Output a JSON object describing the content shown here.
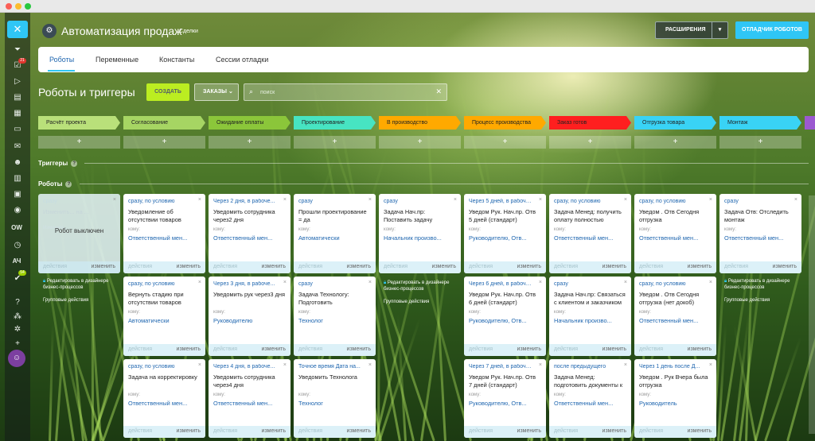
{
  "app": {
    "title": "Автоматизация продаж",
    "subtitle": "Сделки",
    "extensions_label": "РАСШИРЕНИЯ",
    "debugger_label": "ОТЛАДЧИК РОБОТОВ"
  },
  "nav": {
    "badge_tasks": "21",
    "badge_bottom": "54",
    "ow_label": "OW",
    "ac_label": "АЧ"
  },
  "tabs": [
    "Роботы",
    "Переменные",
    "Константы",
    "Сессии отладки"
  ],
  "toolbar": {
    "page_title": "Роботы и триггеры",
    "create_label": "СОЗДАТЬ",
    "orders_label": "ЗАКАЗЫ",
    "search_placeholder": "поиск"
  },
  "stages": [
    {
      "label": "Расчёт проекта",
      "color": "#b9e07a"
    },
    {
      "label": "Согласование",
      "color": "#a6d563"
    },
    {
      "label": "Ожидание оплаты",
      "color": "#8bc63a"
    },
    {
      "label": "Проектирование",
      "color": "#47e4c2"
    },
    {
      "label": "В производство",
      "color": "#ffa900"
    },
    {
      "label": "Процесс производства",
      "color": "#ffa900"
    },
    {
      "label": "Заказ готов",
      "color": "#ff1f1f"
    },
    {
      "label": "Отгрузка товара",
      "color": "#39d3f5"
    },
    {
      "label": "Монтаж",
      "color": "#39d3f5"
    }
  ],
  "add_symbol": "+",
  "sections": {
    "triggers": "Триггеры",
    "robots": "Роботы"
  },
  "card_labels": {
    "komu": "кому:",
    "action": "действия",
    "change": "изменить",
    "close": "×"
  },
  "disabled_card": {
    "text": "Робот выключен",
    "faded_cond": "сразу",
    "faded_title": "Изменить... на ...",
    "faded_sub": "Изменить..."
  },
  "designer_note": {
    "line1": "Редактировать в дизайнере",
    "line2": "бизнес-процессов",
    "group": "Групповые действия"
  },
  "robots": [
    {
      "col": 1,
      "row": 0,
      "cond": "сразу, по условию",
      "title": "Уведомление об отсутствии товаров",
      "rcpt": "Ответственный мен..."
    },
    {
      "col": 2,
      "row": 0,
      "cond": "Через 2 дня, в рабоче...",
      "title": "Уведомить сотрудника через2 дня",
      "rcpt": "Ответственный мен..."
    },
    {
      "col": 3,
      "row": 0,
      "cond": "сразу",
      "title": "Прошли проектирование = да",
      "rcpt": "Автоматически"
    },
    {
      "col": 4,
      "row": 0,
      "cond": "сразу",
      "title": "Задача Нач.пр: Поставить задачу",
      "rcpt": "Начальник произво..."
    },
    {
      "col": 5,
      "row": 0,
      "cond": "Через 5 дней, в рабоче...",
      "title": "Уведом Рук. Нач.пр. Отв 5 дней (стандарт)",
      "rcpt": "Руководителю, Отв..."
    },
    {
      "col": 6,
      "row": 0,
      "cond": "сразу, по условию",
      "title": "Задача Менед: получить оплату полностью",
      "rcpt": "Ответственный мен..."
    },
    {
      "col": 7,
      "row": 0,
      "cond": "сразу, по условию",
      "title": "Уведом . Отв Сегодня отгрузка",
      "rcpt": "Ответственный мен..."
    },
    {
      "col": 8,
      "row": 0,
      "cond": "сразу",
      "title": "Задача Отв: Отследить монтаж",
      "rcpt": "Ответственный мен..."
    },
    {
      "col": 1,
      "row": 1,
      "cond": "сразу, по условию",
      "title": "Вернуть стадию при отсутствии товаров",
      "rcpt": "Автоматически"
    },
    {
      "col": 2,
      "row": 1,
      "cond": "Через 3 дня, в рабоче...",
      "title": "Уведомить рук через3 дня",
      "rcpt": "Руководителю"
    },
    {
      "col": 3,
      "row": 1,
      "cond": "сразу",
      "title": "Задача Технологу: Подготовить",
      "rcpt": "Технолог"
    },
    {
      "col": 5,
      "row": 1,
      "cond": "Через 6 дней, в рабоче...",
      "title": "Уведом Рук. Нач.пр. Отв 6 дней (стандарт)",
      "rcpt": "Руководителю, Отв..."
    },
    {
      "col": 6,
      "row": 1,
      "cond": "сразу",
      "title": "Задача Нач.пр: Связаться с клиентом и заказчиком",
      "rcpt": "Начальник произво..."
    },
    {
      "col": 7,
      "row": 1,
      "cond": "сразу, по условию",
      "title": "Уведом . Отв Сегодня отгрузка (нет докоб)",
      "rcpt": "Ответственный мен..."
    },
    {
      "col": 1,
      "row": 2,
      "cond": "сразу, по условию",
      "title": "Задача на корректировку",
      "rcpt": "Ответственный мен..."
    },
    {
      "col": 2,
      "row": 2,
      "cond": "Через 4 дня, в рабоче...",
      "title": "Уведомить сотрудника через4 дня",
      "rcpt": "Ответственный мен..."
    },
    {
      "col": 3,
      "row": 2,
      "cond": "Точное время Дата на...",
      "title": "Уведомить Технолога",
      "rcpt": "Технолог"
    },
    {
      "col": 5,
      "row": 2,
      "cond": "Через 7 дней, в рабоче...",
      "title": "Уведом Рук. Нач.пр. Отв 7 дней (стандарт)",
      "rcpt": "Руководителю, Отв..."
    },
    {
      "col": 6,
      "row": 2,
      "cond": "после предыдущего",
      "title": "Задача Менед: подготовить документы к",
      "rcpt": "Ответственный мен..."
    },
    {
      "col": 7,
      "row": 2,
      "cond": "Через 1 день после Д...",
      "title": "Уведом . Рук Вчера была отгрузка",
      "rcpt": "Руководитель"
    }
  ]
}
